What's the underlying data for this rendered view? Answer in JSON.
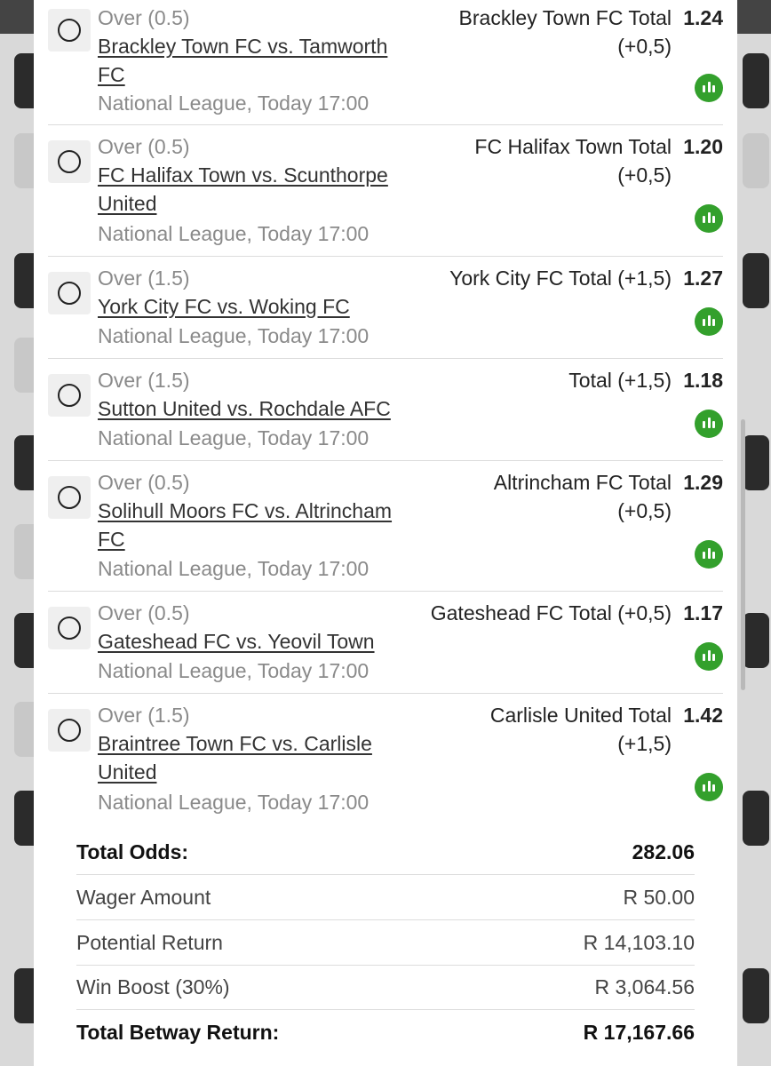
{
  "bets": [
    {
      "market": "Over (0.5)",
      "match_lines": [
        "Brackley Town FC vs. Tamworth",
        "FC"
      ],
      "league": "National League, Today 17:00",
      "selection_lines": [
        "Brackley Town FC Total",
        "(+0,5)"
      ],
      "odds": "1.24"
    },
    {
      "market": "Over (0.5)",
      "match_lines": [
        "FC Halifax Town vs. Scunthorpe",
        "United"
      ],
      "league": "National League, Today 17:00",
      "selection_lines": [
        "FC Halifax Town Total",
        "(+0,5)"
      ],
      "odds": "1.20"
    },
    {
      "market": "Over (1.5)",
      "match_lines": [
        "York City FC vs. Woking FC"
      ],
      "league": "National League, Today 17:00",
      "selection_lines": [
        "York City FC Total (+1,5)"
      ],
      "odds": "1.27"
    },
    {
      "market": "Over (1.5)",
      "match_lines": [
        "Sutton United vs. Rochdale AFC"
      ],
      "league": "National League, Today 17:00",
      "selection_lines": [
        "Total (+1,5)"
      ],
      "odds": "1.18"
    },
    {
      "market": "Over (0.5)",
      "match_lines": [
        "Solihull Moors FC vs. Altrincham",
        "FC"
      ],
      "league": "National League, Today 17:00",
      "selection_lines": [
        "Altrincham FC Total",
        "(+0,5)"
      ],
      "odds": "1.29"
    },
    {
      "market": "Over (0.5)",
      "match_lines": [
        "Gateshead FC vs. Yeovil Town"
      ],
      "league": "National League, Today 17:00",
      "selection_lines": [
        "Gateshead FC Total (+0,5)"
      ],
      "odds": "1.17"
    },
    {
      "market": "Over (1.5)",
      "match_lines": [
        "Braintree Town FC vs. Carlisle",
        "United"
      ],
      "league": "National League, Today 17:00",
      "selection_lines": [
        "Carlisle United Total",
        "(+1,5)"
      ],
      "odds": "1.42"
    }
  ],
  "summary": {
    "total_odds_label": "Total Odds:",
    "total_odds_value": "282.06",
    "wager_label": "Wager Amount",
    "wager_value": "R 50.00",
    "potential_label": "Potential Return",
    "potential_value": "R 14,103.10",
    "boost_label": "Win Boost (30%)",
    "boost_value": "R 3,064.56",
    "total_return_label": "Total Betway Return:",
    "total_return_value": "R 17,167.66"
  },
  "colors": {
    "stats_icon": "#33a02c",
    "muted_text": "#8a8a8a",
    "divider": "#dcdcdc"
  },
  "icons": {
    "radio": "radio-unchecked-icon",
    "stats": "bar-chart-icon"
  }
}
